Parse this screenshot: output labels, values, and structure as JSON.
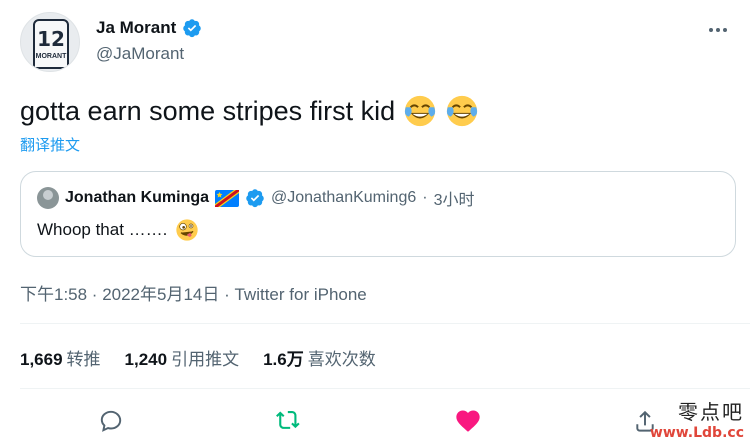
{
  "author": {
    "display_name": "Ja Morant",
    "handle": "@JaMorant",
    "avatar_jersey_number": "12",
    "avatar_jersey_name": "MORANT"
  },
  "tweet": {
    "text": "gotta earn some stripes first kid",
    "emoji": [
      "face-with-tears-of-joy",
      "face-with-tears-of-joy"
    ],
    "translate_label": "翻译推文"
  },
  "quoted_tweet": {
    "display_name": "Jonathan Kuminga",
    "handle": "@JonathanKuming6",
    "separator": "·",
    "time": "3小时",
    "text": "Whoop that …….",
    "emoji": "zany-face",
    "flag": "dr-congo-flag"
  },
  "timestamp": "下午1:58 · 2022年5月14日 · Twitter for iPhone",
  "stats": [
    {
      "value": "1,669",
      "label": "转推"
    },
    {
      "value": "1,240",
      "label": "引用推文"
    },
    {
      "value": "1.6万",
      "label": "喜欢次数"
    }
  ],
  "watermark": {
    "top": "零点吧",
    "url": "www.Ldb.cc"
  },
  "colors": {
    "accent": "#1d9bf0",
    "retweet": "#00ba7c",
    "like": "#f91880",
    "secondary_text": "#536471"
  }
}
